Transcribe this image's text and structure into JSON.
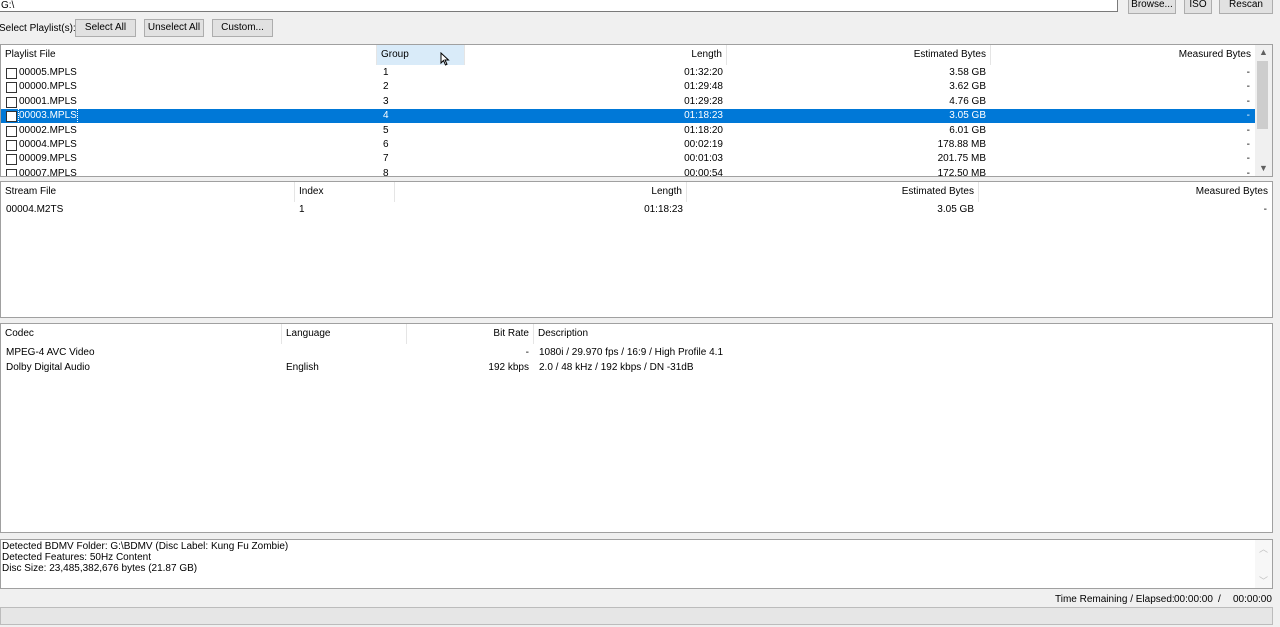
{
  "path": {
    "value": "G:\\"
  },
  "toolbar": {
    "browse": "Browse...",
    "iso": "ISO",
    "rescan": "Rescan"
  },
  "select": {
    "label": "Select Playlist(s):",
    "select_all": "Select All",
    "unselect_all": "Unselect All",
    "custom": "Custom..."
  },
  "playlist": {
    "headers": {
      "file": "Playlist File",
      "group": "Group",
      "length": "Length",
      "estimated": "Estimated Bytes",
      "measured": "Measured Bytes"
    },
    "rows": [
      {
        "file": "00005.MPLS",
        "group": "1",
        "length": "01:32:20",
        "estimated": "3.58 GB",
        "measured": "-"
      },
      {
        "file": "00000.MPLS",
        "group": "2",
        "length": "01:29:48",
        "estimated": "3.62 GB",
        "measured": "-"
      },
      {
        "file": "00001.MPLS",
        "group": "3",
        "length": "01:29:28",
        "estimated": "4.76 GB",
        "measured": "-"
      },
      {
        "file": "00003.MPLS",
        "group": "4",
        "length": "01:18:23",
        "estimated": "3.05 GB",
        "measured": "-"
      },
      {
        "file": "00002.MPLS",
        "group": "5",
        "length": "01:18:20",
        "estimated": "6.01 GB",
        "measured": "-"
      },
      {
        "file": "00004.MPLS",
        "group": "6",
        "length": "00:02:19",
        "estimated": "178.88 MB",
        "measured": "-"
      },
      {
        "file": "00009.MPLS",
        "group": "7",
        "length": "00:01:03",
        "estimated": "201.75 MB",
        "measured": "-"
      },
      {
        "file": "00007.MPLS",
        "group": "8",
        "length": "00:00:54",
        "estimated": "172.50 MB",
        "measured": "-"
      }
    ]
  },
  "streams": {
    "headers": {
      "file": "Stream File",
      "index": "Index",
      "length": "Length",
      "estimated": "Estimated Bytes",
      "measured": "Measured Bytes"
    },
    "rows": [
      {
        "file": "00004.M2TS",
        "index": "1",
        "length": "01:18:23",
        "estimated": "3.05 GB",
        "measured": "-"
      }
    ]
  },
  "codecs": {
    "headers": {
      "codec": "Codec",
      "language": "Language",
      "bitrate": "Bit Rate",
      "description": "Description"
    },
    "rows": [
      {
        "codec": "MPEG-4 AVC Video",
        "language": "",
        "bitrate": "-",
        "description": "1080i / 29.970 fps / 16:9 / High Profile 4.1"
      },
      {
        "codec": "Dolby Digital Audio",
        "language": "English",
        "bitrate": "192 kbps",
        "description": "2.0 / 48 kHz /  192 kbps / DN -31dB"
      }
    ]
  },
  "log": {
    "line1": "Detected BDMV Folder: G:\\BDMV (Disc Label: Kung Fu Zombie)",
    "line2": "Detected Features: 50Hz Content",
    "line3": "Disc Size: 23,485,382,676 bytes (21.87 GB)"
  },
  "status": {
    "label": "Time Remaining / Elapsed:",
    "remaining": "00:00:00",
    "sep": "/",
    "elapsed": "00:00:00"
  },
  "colors": {
    "selection": "#0078d7",
    "sorted_header": "#d9ebf9"
  }
}
